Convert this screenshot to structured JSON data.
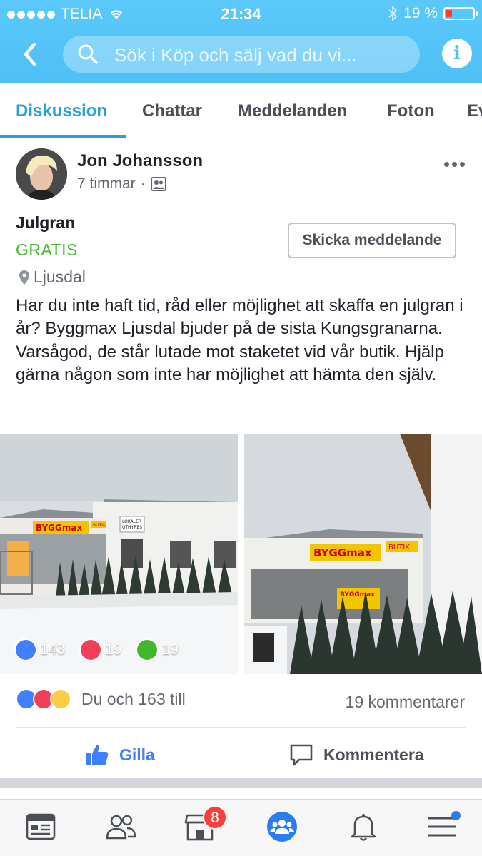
{
  "status": {
    "carrier": "TELIA",
    "time": "21:34",
    "battery": "19 %"
  },
  "header": {
    "search_placeholder": "Sök i Köp och sälj vad du vi..."
  },
  "tabs": [
    {
      "label": "Diskussion",
      "active": true
    },
    {
      "label": "Chattar"
    },
    {
      "label": "Meddelanden"
    },
    {
      "label": "Foton"
    },
    {
      "label": "Ev"
    }
  ],
  "post": {
    "author": "Jon Johansson",
    "time": "7 timmar",
    "title": "Julgran",
    "price": "GRATIS",
    "location": "Ljusdal",
    "message_button": "Skicka meddelande",
    "description": "Har du inte haft tid, råd eller möjlighet att skaffa en julgran i år? Byggmax Ljusdal bjuder på de sista Kungsgranarna. Varsågod, de står lutade mot staketet vid vår butik. Hjälp gärna någon som inte har möjlighet att hämta den själv.",
    "photo_counts": {
      "likes": "143",
      "loves": "19",
      "comments": "19"
    },
    "photo1_signs": {
      "store": "BYGGmax",
      "butik": "BUTIK",
      "lokaler": "LOKALER",
      "uthyres": "UTHYRES"
    },
    "photo2_signs": {
      "store": "BYGGmax",
      "butik": "BUTIK",
      "small_store": "BYGGmax"
    },
    "reactions_text": "Du och 163 till",
    "comments_text": "19 kommentarer",
    "actions": {
      "like": "Gilla",
      "comment": "Kommentera"
    }
  },
  "bottom_nav": {
    "marketplace_badge": "8"
  },
  "colors": {
    "header": "#4fc0f5",
    "accent": "#2b9fd9",
    "price": "#42b72a",
    "like": "#4080ff"
  }
}
